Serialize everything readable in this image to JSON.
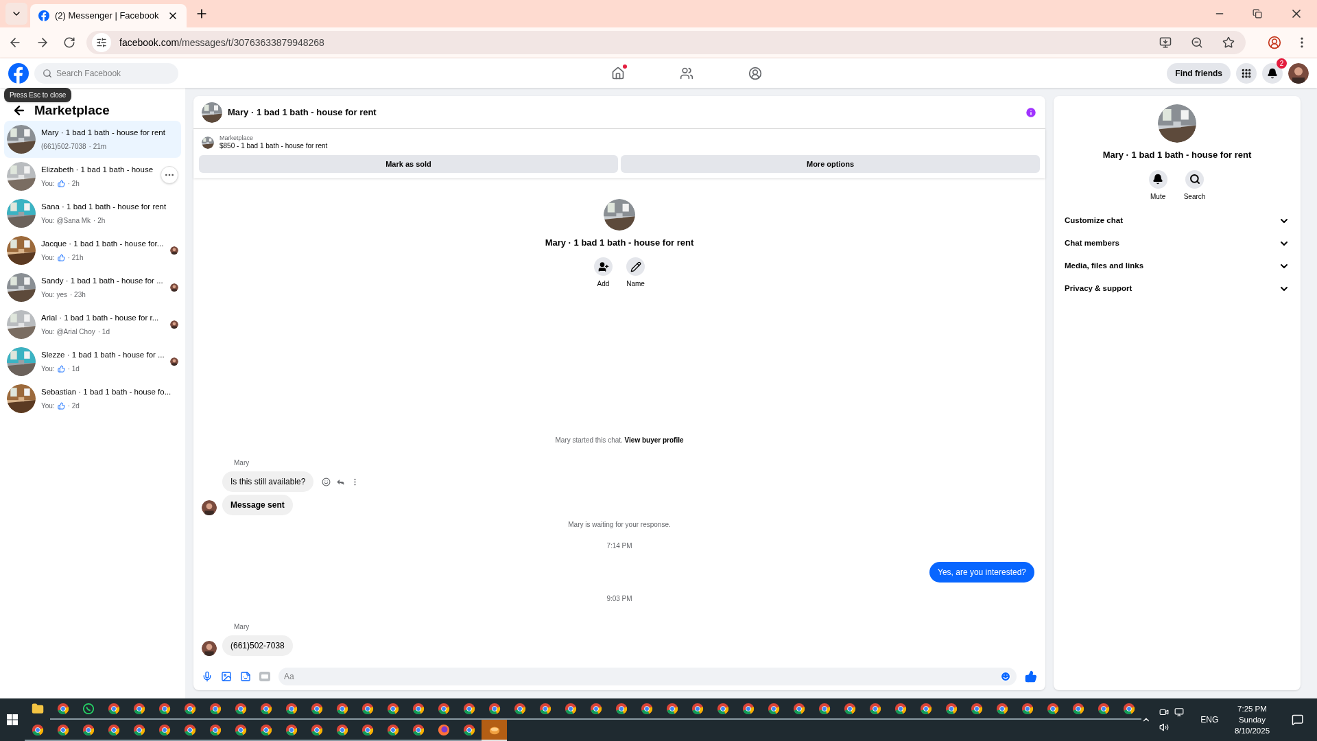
{
  "browser": {
    "tab_title": "(2) Messenger | Facebook",
    "url_host": "facebook.com",
    "url_path": "/messages/t/30763633879948268"
  },
  "topnav": {
    "search_placeholder": "Search Facebook",
    "find_friends": "Find friends",
    "notification_count": "2",
    "home_dot": true
  },
  "tooltip": "Press Esc to close",
  "sidebar": {
    "title": "Marketplace",
    "items": [
      {
        "name": "Mary · 1 bad 1 bath - house for rent",
        "prefix": "(661)502-7038",
        "like": false,
        "suffix": "· 21m",
        "selected": true,
        "seen": false,
        "more": false
      },
      {
        "name": "Elizabeth · 1 bad 1 bath - house",
        "prefix": "You:",
        "like": true,
        "suffix": "· 2h",
        "selected": false,
        "seen": false,
        "more": true
      },
      {
        "name": "Sana · 1 bad 1 bath - house for rent",
        "prefix": "You: @Sana Mk",
        "like": false,
        "suffix": "· 2h",
        "selected": false,
        "seen": false,
        "more": false
      },
      {
        "name": "Jacque · 1 bad 1 bath - house for...",
        "prefix": "You:",
        "like": true,
        "suffix": "· 21h",
        "selected": false,
        "seen": true,
        "more": false
      },
      {
        "name": "Sandy · 1 bad 1 bath - house for ...",
        "prefix": "You: yes",
        "like": false,
        "suffix": "· 23h",
        "selected": false,
        "seen": true,
        "more": false
      },
      {
        "name": "Arial · 1 bad 1 bath - house for r...",
        "prefix": "You: @Arial Choy",
        "like": false,
        "suffix": "· 1d",
        "selected": false,
        "seen": true,
        "more": false
      },
      {
        "name": "Slezze · 1 bad 1 bath - house for ...",
        "prefix": "You:",
        "like": true,
        "suffix": "· 1d",
        "selected": false,
        "seen": true,
        "more": false
      },
      {
        "name": "Sebastian · 1 bad 1 bath - house fo...",
        "prefix": "You:",
        "like": true,
        "suffix": "· 2d",
        "selected": false,
        "seen": false,
        "more": false
      }
    ]
  },
  "chat": {
    "title": "Mary · 1 bad 1 bath - house for rent",
    "listing_label": "Marketplace",
    "listing_title": "$850 - 1 bad 1 bath - house for rent",
    "buttons": [
      "Mark as sold",
      "More options"
    ],
    "profile_name": "Mary · 1 bad 1 bath - house for rent",
    "profile_actions": [
      {
        "kind": "add",
        "label": "Add"
      },
      {
        "kind": "name",
        "label": "Name"
      }
    ],
    "messages": [
      {
        "kind": "notice",
        "text": "Mary started this chat.",
        "link": "View buyer profile"
      },
      {
        "kind": "sender",
        "text": "Mary"
      },
      {
        "kind": "incoming",
        "text": "Is this still available?",
        "avatar": false,
        "actions": true,
        "bold": false
      },
      {
        "kind": "incoming",
        "text": "Message sent",
        "avatar": true,
        "actions": false,
        "bold": true
      },
      {
        "kind": "notice",
        "text": "Mary is waiting for your response."
      },
      {
        "kind": "time",
        "text": "7:14 PM"
      },
      {
        "kind": "outgoing",
        "text": "Yes, are you interested?"
      },
      {
        "kind": "time",
        "text": "9:03 PM"
      },
      {
        "kind": "sender",
        "text": "Mary"
      },
      {
        "kind": "incoming",
        "text": "(661)502-7038",
        "avatar": true,
        "actions": false,
        "bold": false
      }
    ],
    "composer_placeholder": "Aa"
  },
  "details": {
    "title": "Mary · 1 bad 1 bath - house for rent",
    "actions": [
      {
        "kind": "mute",
        "label": "Mute"
      },
      {
        "kind": "search",
        "label": "Search"
      }
    ],
    "sections": [
      {
        "label": "Customize chat",
        "expanded": false
      },
      {
        "label": "Chat members",
        "expanded": false
      },
      {
        "label": "Media, files and links",
        "expanded": false
      },
      {
        "label": "Privacy & support",
        "expanded": false
      }
    ]
  },
  "taskbar": {
    "row_1": [
      {
        "kind": "folder"
      },
      {
        "kind": "chrome"
      },
      {
        "kind": "whatsapp"
      },
      {
        "kind": "chrome"
      },
      {
        "kind": "chrome"
      },
      {
        "kind": "chrome"
      },
      {
        "kind": "chrome"
      },
      {
        "kind": "chrome"
      },
      {
        "kind": "chrome"
      },
      {
        "kind": "chrome"
      },
      {
        "kind": "chrome"
      },
      {
        "kind": "chrome"
      },
      {
        "kind": "chrome"
      },
      {
        "kind": "chrome"
      },
      {
        "kind": "chrome"
      },
      {
        "kind": "chrome"
      },
      {
        "kind": "chrome"
      },
      {
        "kind": "chrome"
      },
      {
        "kind": "chrome"
      },
      {
        "kind": "chrome"
      },
      {
        "kind": "chrome"
      },
      {
        "kind": "chrome"
      },
      {
        "kind": "chrome"
      },
      {
        "kind": "chrome"
      },
      {
        "kind": "chrome"
      },
      {
        "kind": "chrome"
      },
      {
        "kind": "chrome"
      },
      {
        "kind": "chrome"
      },
      {
        "kind": "chrome"
      },
      {
        "kind": "chrome"
      },
      {
        "kind": "chrome"
      },
      {
        "kind": "chrome"
      },
      {
        "kind": "chrome"
      },
      {
        "kind": "chrome"
      },
      {
        "kind": "chrome"
      },
      {
        "kind": "chrome"
      },
      {
        "kind": "chrome"
      },
      {
        "kind": "chrome"
      },
      {
        "kind": "chrome"
      },
      {
        "kind": "chrome"
      },
      {
        "kind": "chrome"
      },
      {
        "kind": "chrome"
      },
      {
        "kind": "chrome"
      },
      {
        "kind": "chrome"
      }
    ],
    "row_2": [
      {
        "kind": "chrome"
      },
      {
        "kind": "chrome"
      },
      {
        "kind": "chrome"
      },
      {
        "kind": "chrome"
      },
      {
        "kind": "chrome"
      },
      {
        "kind": "chrome"
      },
      {
        "kind": "chrome"
      },
      {
        "kind": "chrome"
      },
      {
        "kind": "chrome"
      },
      {
        "kind": "chrome"
      },
      {
        "kind": "chrome"
      },
      {
        "kind": "chrome"
      },
      {
        "kind": "chrome"
      },
      {
        "kind": "chrome"
      },
      {
        "kind": "chrome"
      },
      {
        "kind": "chrome"
      },
      {
        "kind": "firefox"
      },
      {
        "kind": "chrome"
      },
      {
        "kind": "app"
      }
    ],
    "language": "ENG",
    "time": "7:25 PM",
    "day": "Sunday",
    "date": "8/10/2025"
  }
}
